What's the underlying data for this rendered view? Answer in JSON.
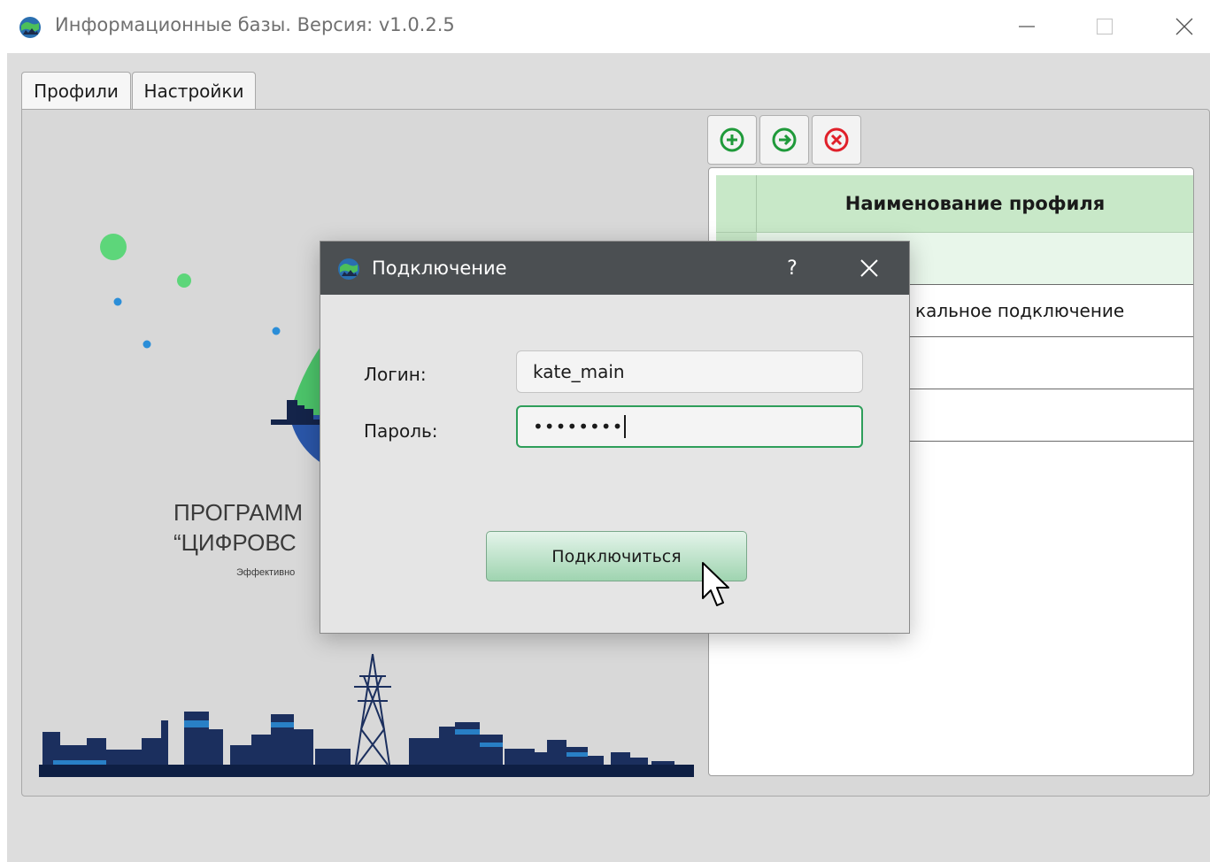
{
  "window": {
    "title": "Информационные базы. Версия: v1.0.2.5",
    "icon": "globe-icon",
    "controls": [
      "minimize-icon",
      "maximize-icon",
      "close-icon"
    ]
  },
  "tabs": [
    {
      "label": "Профили",
      "selected": true
    },
    {
      "label": "Настройки",
      "selected": false
    }
  ],
  "toolbar": {
    "buttons": [
      {
        "icon": "add-circle-icon",
        "color": "#1f9a3a"
      },
      {
        "icon": "arrow-right-circle-icon",
        "color": "#1f9a3a"
      },
      {
        "icon": "remove-circle-icon",
        "color": "#e0202a"
      }
    ]
  },
  "profiles_table": {
    "header": "Наименование профиля",
    "rows": [
      {
        "name": ""
      },
      {
        "name": "кальное подключение"
      },
      {
        "name": ""
      },
      {
        "name": ""
      }
    ]
  },
  "background": {
    "line1": "ПРОГРАММ",
    "line2": "“ЦИФРОВС",
    "line3": "Эффективно"
  },
  "dialog": {
    "title": "Подключение",
    "help": "?",
    "login_label": "Логин:",
    "login_value": "kate_main",
    "password_label": "Пароль:",
    "password_value": "••••••••",
    "connect_label": "Подключиться"
  },
  "colors": {
    "accent_green": "#2e9e5a",
    "table_header": "#c8e8c8",
    "dialog_title": "#4b4f52"
  }
}
